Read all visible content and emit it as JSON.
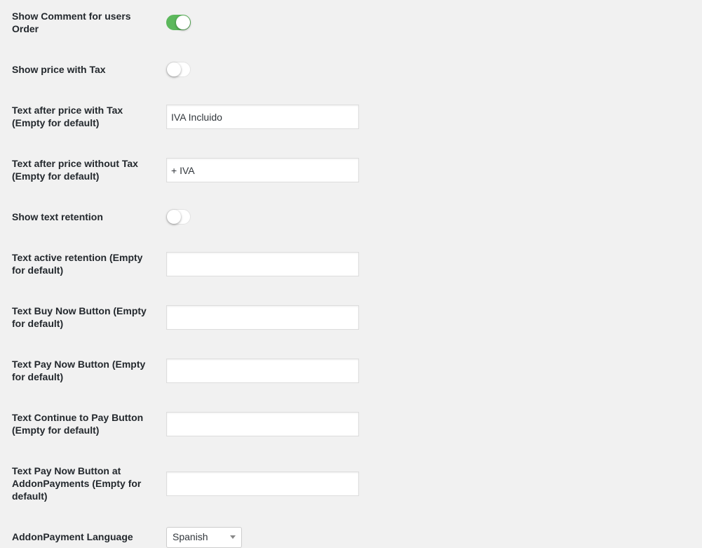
{
  "settings": {
    "show_comment": {
      "label": "Show Comment for users Order",
      "enabled": true
    },
    "show_price_tax": {
      "label": "Show price with Tax",
      "enabled": false
    },
    "text_with_tax": {
      "label": "Text after price with Tax (Empty for default)",
      "value": "IVA Incluido"
    },
    "text_without_tax": {
      "label": "Text after price without Tax (Empty for default)",
      "value": "+ IVA"
    },
    "show_retention": {
      "label": "Show text retention",
      "enabled": false
    },
    "text_retention": {
      "label": "Text active retention (Empty for default)",
      "value": ""
    },
    "text_buy_now": {
      "label": "Text Buy Now Button (Empty for default)",
      "value": ""
    },
    "text_pay_now": {
      "label": "Text Pay Now Button (Empty for default)",
      "value": ""
    },
    "text_continue_pay": {
      "label": "Text Continue to Pay Button (Empty for default)",
      "value": ""
    },
    "text_pay_now_addon": {
      "label": "Text Pay Now Button at AddonPayments (Empty for default)",
      "value": ""
    },
    "addon_language": {
      "label": "AddonPayment Language",
      "selected": "Spanish"
    }
  },
  "colors": {
    "toggle_on": "#5cb85c",
    "background": "#f1f1f1"
  }
}
